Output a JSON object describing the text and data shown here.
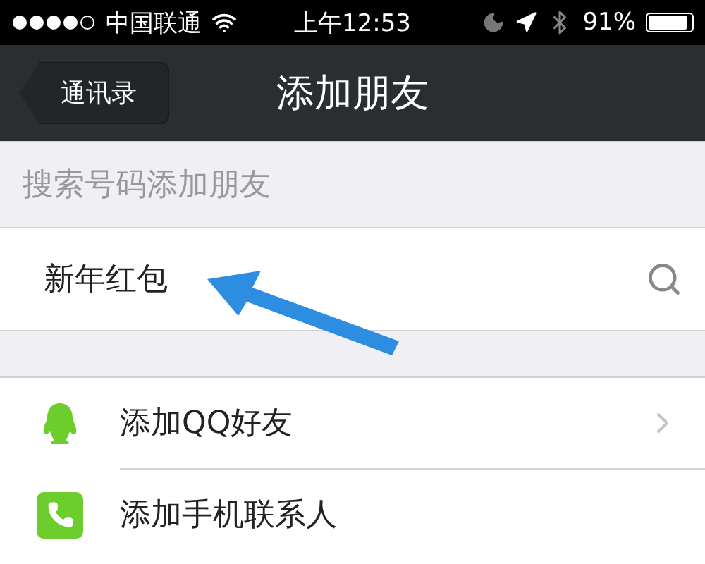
{
  "status_bar": {
    "carrier": "中国联通",
    "time": "上午12:53",
    "battery": "91%"
  },
  "nav_bar": {
    "back": "通讯录",
    "title": "添加朋友"
  },
  "search_section": {
    "header": "搜索号码添加朋友",
    "field": {
      "value": "新年红包"
    }
  },
  "menu": [
    {
      "kind": "qq",
      "label": "添加QQ好友",
      "chevron": true
    },
    {
      "kind": "phone",
      "label": "添加手机联系人",
      "chevron": false
    }
  ]
}
